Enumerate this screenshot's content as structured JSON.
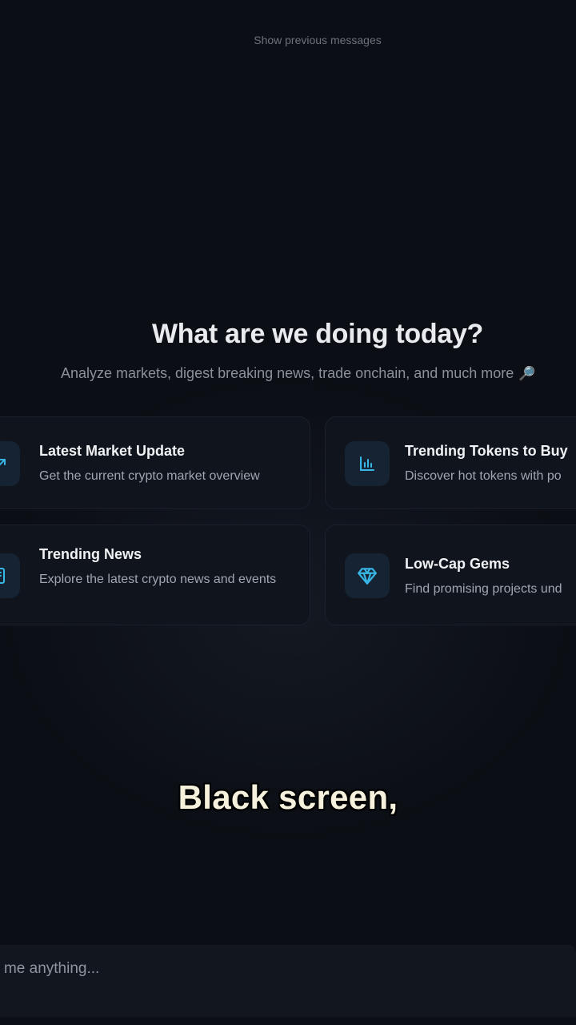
{
  "chat": {
    "show_previous": "Show previous messages"
  },
  "hero": {
    "title": "What are we doing today?",
    "subtitle": "Analyze markets, digest breaking news, trade onchain, and much more",
    "subtitle_emoji": "🔎"
  },
  "suggestions": [
    {
      "title": "Latest Market Update",
      "description": "Get the current crypto market overview",
      "icon": "trending-up-icon"
    },
    {
      "title": "Trending Tokens to Buy",
      "description": "Discover hot tokens with po",
      "icon": "bar-chart-icon"
    },
    {
      "title": "Trending News",
      "description": "Explore the latest crypto news and events",
      "icon": "newspaper-icon"
    },
    {
      "title": "Low-Cap Gems",
      "description": "Find promising projects und",
      "icon": "diamond-icon"
    }
  ],
  "caption": {
    "text": "Black screen,"
  },
  "composer": {
    "placeholder": "Ask me anything..."
  },
  "colors": {
    "background": "#0b0e14",
    "card": "#10141c",
    "icon_accent": "#38b6e6"
  }
}
